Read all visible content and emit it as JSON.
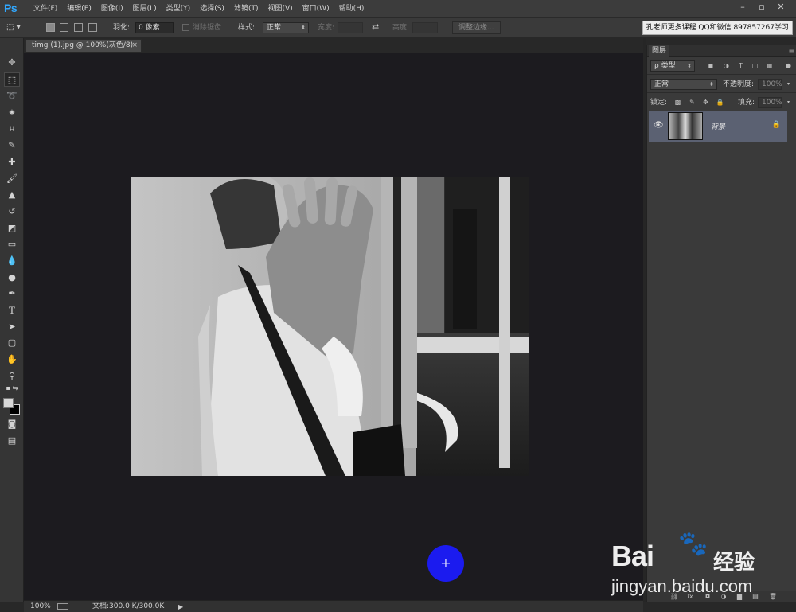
{
  "app": {
    "logo": "Ps"
  },
  "menu": [
    "文件(F)",
    "编辑(E)",
    "图像(I)",
    "图层(L)",
    "类型(Y)",
    "选择(S)",
    "滤镜(T)",
    "视图(V)",
    "窗口(W)",
    "帮助(H)"
  ],
  "window_controls": {
    "minimize": "–",
    "restore": "▫",
    "close": "✕"
  },
  "options": {
    "feather_label": "羽化:",
    "feather_value": "0 像素",
    "antialias_label": "消除锯齿",
    "style_label": "样式:",
    "style_value": "正常",
    "width_label": "宽度:",
    "height_label": "高度:",
    "refine_edge_button": "调整边缘...",
    "promo_text": "孔老师更多课程 QQ和微信 897857267学习"
  },
  "document_tab": {
    "title": "timg (1).jpg @ 100%(灰色/8)",
    "close": "×"
  },
  "layers_panel": {
    "tab": "图层",
    "filter_value": "ρ 类型",
    "blend_mode": "正常",
    "opacity_label": "不透明度:",
    "opacity_value": "100%",
    "lock_label": "锁定:",
    "fill_label": "填充:",
    "fill_value": "100%",
    "layers": [
      {
        "name": "背景",
        "visible": true,
        "locked": true
      }
    ]
  },
  "status": {
    "zoom": "100%",
    "doc_info": "文档:300.0 K/300.0K"
  },
  "watermark": {
    "brand": "Bai",
    "paw": "🐾",
    "brand_cn": "经验",
    "url": "jingyan.baidu.com"
  },
  "colors": {
    "accent": "#31a8ff",
    "cursor_highlight": "#1b1bef",
    "layer_selected": "#5b6172",
    "canvas_bg": "#1c1b1f"
  }
}
